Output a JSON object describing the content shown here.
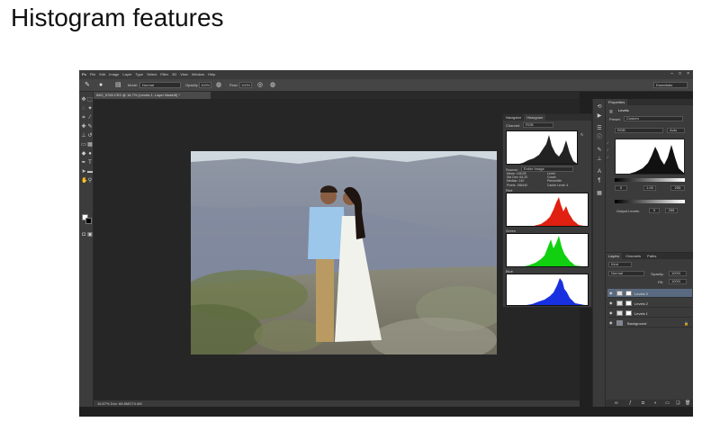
{
  "slide": {
    "title": "Histogram features"
  },
  "app": {
    "menu": [
      "Ps",
      "File",
      "Edit",
      "Image",
      "Layer",
      "Type",
      "Select",
      "Filter",
      "3D",
      "View",
      "Window",
      "Help"
    ],
    "window_controls": [
      "–",
      "□",
      "×"
    ],
    "workspace": "Essentials",
    "options": {
      "mode_label": "Mode:",
      "mode_value": "Normal",
      "opacity_label": "Opacity:",
      "opacity_value": "100%",
      "flow_label": "Flow:",
      "flow_value": "100%"
    },
    "document_tab": "IMG_9765.CR2 @ 16.7% (Levels 1, Layer Mask/8) *",
    "status": "16.67%   Doc: 68.6M/274.4M"
  },
  "histogram": {
    "tabs": [
      "Navigator",
      "Histogram"
    ],
    "channel_label": "Channel:",
    "channel_value": "RGB",
    "source_label": "Source:",
    "source_value": "Entire Image",
    "stats_left": [
      "Mean: 135.05",
      "Std Dev: 64.20",
      "Median: 140",
      "Pixels: 198440"
    ],
    "stats_right": [
      "Level:",
      "Count:",
      "Percentile:",
      "Cache Level: 4"
    ],
    "channels": [
      {
        "name": "Red",
        "color": "#e02010"
      },
      {
        "name": "Green",
        "color": "#10d010"
      },
      {
        "name": "Blue",
        "color": "#1830e0"
      }
    ]
  },
  "properties": {
    "tab": "Properties",
    "panel_title": "Levels",
    "preset_label": "Preset:",
    "preset_value": "Custom",
    "channel_value": "RGB",
    "auto_label": "Auto",
    "input_values": [
      "0",
      "1.00",
      "255"
    ],
    "output_label": "Output Levels:",
    "output_values": [
      "0",
      "255"
    ]
  },
  "layers": {
    "tabs": [
      "Layers",
      "Channels",
      "Paths"
    ],
    "kind_value": "Kind",
    "blend_value": "Normal",
    "opacity_label": "Opacity:",
    "opacity_value": "100%",
    "fill_label": "Fill:",
    "fill_value": "100%",
    "items": [
      {
        "name": "Levels 3"
      },
      {
        "name": "Levels 2"
      },
      {
        "name": "Levels 1"
      },
      {
        "name": "Background"
      }
    ]
  }
}
